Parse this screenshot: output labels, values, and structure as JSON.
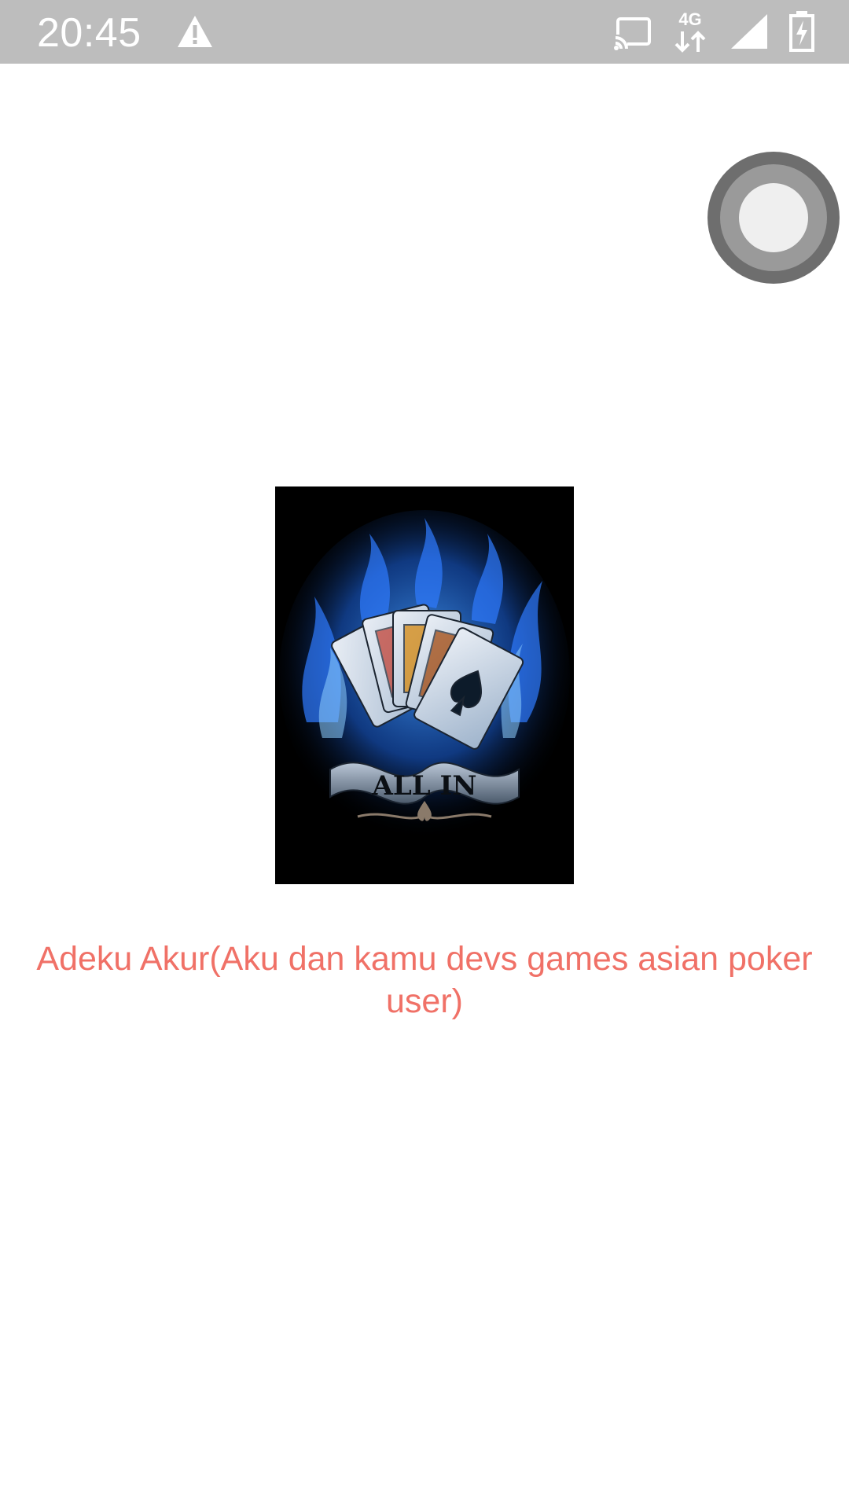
{
  "status_bar": {
    "time": "20:45",
    "network_type": "4G",
    "icons": [
      "warning-icon",
      "cast-icon",
      "network-4g-icon",
      "signal-icon",
      "battery-charging-icon"
    ],
    "background_color": "#bdbdbd"
  },
  "floating_button": {
    "icon": "assistive-touch-icon"
  },
  "cover_image": {
    "banner_text": "ALL IN",
    "description_icon": "playing-cards-flames-icon"
  },
  "caption": {
    "text": "Adeku Akur(Aku dan kamu devs games asian poker user)",
    "color": "#f07167"
  }
}
